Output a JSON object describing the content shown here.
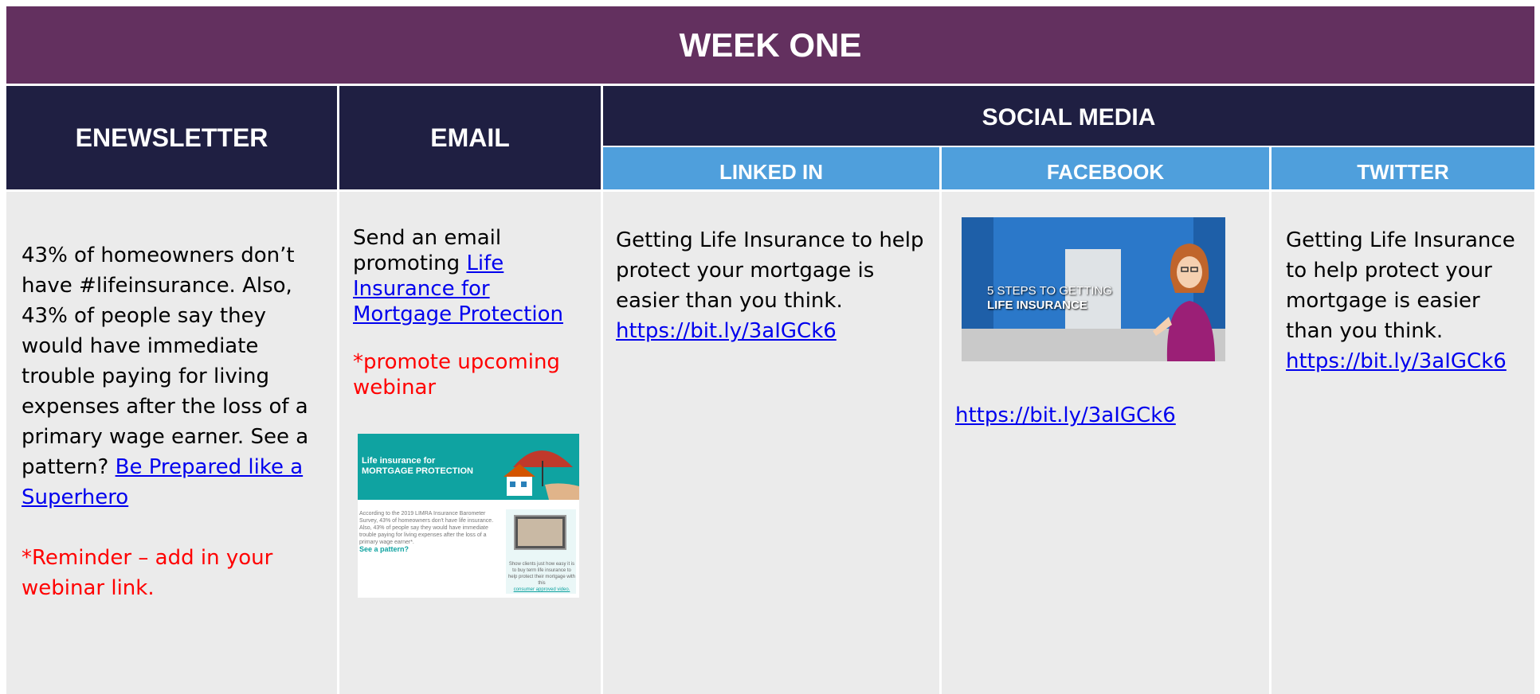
{
  "week_title": "WEEK ONE",
  "columns": {
    "enewsletter": "ENEWSLETTER",
    "email": "EMAIL",
    "social_media": "SOCIAL MEDIA",
    "linkedin": "LINKED IN",
    "facebook": "FACEBOOK",
    "twitter": "TWITTER"
  },
  "enewsletter": {
    "text": "43% of homeowners don’t have #lifeinsurance.  Also, 43% of people say they would have immediate trouble paying for living expenses after the loss of a primary wage earner.  See a pattern? ",
    "link": "Be Prepared like a Superhero",
    "reminder": "*Reminder – add in your webinar link."
  },
  "email": {
    "text": "Send an email promoting ",
    "link": "Life Insurance for Mortgage Protection",
    "note": "*promote upcoming webinar",
    "thumb": {
      "title_line1": "Life insurance for",
      "title_line2": "MORTGAGE PROTECTION",
      "body": "According to the 2019 LIMRA Insurance Barometer Survey, 43% of homeowners don't have life insurance. Also, 43% of people say they would have immediate trouble paying for living expenses after the loss of a primary wage earner*.",
      "see": "See a pattern?",
      "caption": "Show clients just how easy it is to buy term life insurance to help protect their mortgage with this",
      "caption_link": "consumer approved video."
    }
  },
  "linkedin": {
    "text": "Getting Life Insurance to help protect your mortgage is easier than you think. ",
    "link": "https://bit.ly/3aIGCk6"
  },
  "facebook": {
    "image_text_line1": "5 STEPS TO GETTING",
    "image_text_line2": "LIFE INSURANCE",
    "link": "https://bit.ly/3aIGCk6"
  },
  "twitter": {
    "text": "Getting Life Insurance to help protect your mortgage is easier than you think. ",
    "link": "https://bit.ly/3aIGCk6"
  },
  "colors": {
    "week_header": "#63305f",
    "dark_header": "#1f1f42",
    "blue_header": "#4f9fdc",
    "body": "#ebebeb",
    "link": "#0000ee",
    "note": "#ff0000"
  }
}
